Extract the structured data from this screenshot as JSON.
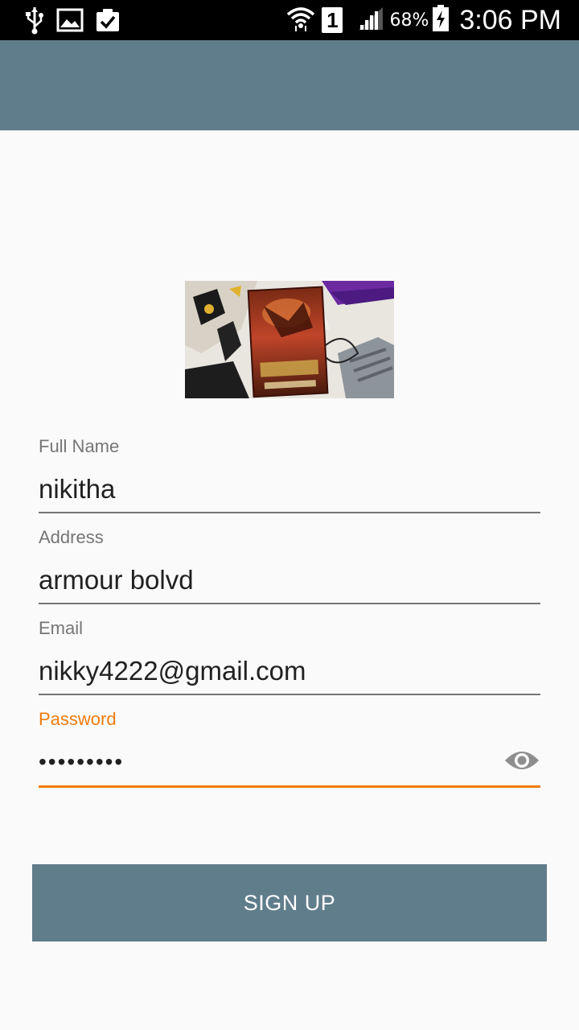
{
  "status_bar": {
    "icons": [
      "usb-icon",
      "image-icon",
      "clipboard-check-icon",
      "wifi-icon",
      "sim-icon",
      "signal-icon",
      "battery-charging-icon"
    ],
    "sim_label": "1",
    "battery_percent": "68%",
    "time": "3:06 PM"
  },
  "app_bar": {
    "color": "#607d8b"
  },
  "cover_image": {
    "description": "book-cover-photo"
  },
  "form": {
    "full_name": {
      "label": "Full Name",
      "value": "nikitha"
    },
    "address": {
      "label": "Address",
      "value": "armour bolvd"
    },
    "email": {
      "label": "Email",
      "value": "nikky4222@gmail.com"
    },
    "password": {
      "label": "Password",
      "value": "•••••••••",
      "focused": true,
      "toggle_icon": "eye-icon"
    }
  },
  "signup_button": {
    "label": "SIGN UP"
  },
  "colors": {
    "primary": "#607d8b",
    "accent": "#ef7c0f",
    "background": "#fafafa"
  }
}
